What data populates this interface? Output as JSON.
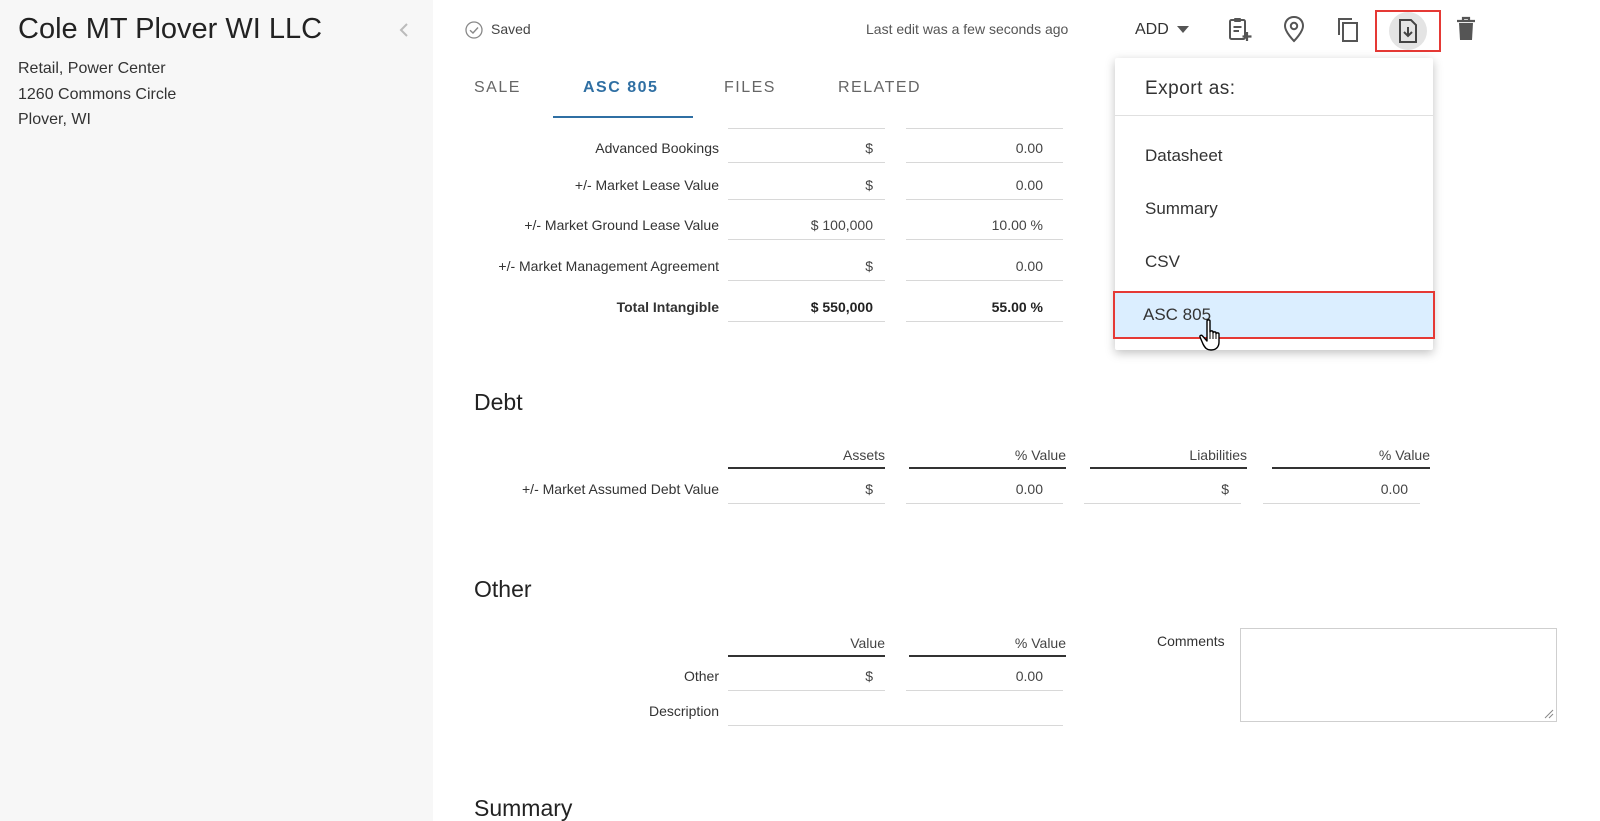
{
  "sidebar": {
    "title": "Cole MT Plover WI LLC",
    "property_type": "Retail, Power Center",
    "address_line1": "1260 Commons Circle",
    "address_line2": "Plover, WI"
  },
  "topbar": {
    "saved_label": "Saved",
    "last_edit": "Last edit was a few seconds ago",
    "add_label": "ADD"
  },
  "tabs": [
    {
      "label": "SALE"
    },
    {
      "label": "ASC 805"
    },
    {
      "label": "FILES"
    },
    {
      "label": "RELATED"
    }
  ],
  "intangible": {
    "rows": [
      {
        "label": "Advanced Bookings",
        "value": "$",
        "percent": "0.00"
      },
      {
        "label": "+/- Market Lease Value",
        "value": "$",
        "percent": "0.00"
      },
      {
        "label": "+/- Market Ground Lease Value",
        "value": "$ 100,000",
        "percent": "10.00 %"
      },
      {
        "label": "+/- Market Management Agreement",
        "value": "$",
        "percent": "0.00"
      }
    ],
    "total": {
      "label": "Total Intangible",
      "value": "$ 550,000",
      "percent": "55.00 %"
    }
  },
  "debt": {
    "title": "Debt",
    "headers": [
      "Assets",
      "% Value",
      "Liabilities",
      "% Value"
    ],
    "row": {
      "label": "+/- Market Assumed Debt Value",
      "assets": "$",
      "assets_pct": "0.00",
      "liabilities": "$",
      "liabilities_pct": "0.00"
    }
  },
  "other": {
    "title": "Other",
    "headers": [
      "Value",
      "% Value"
    ],
    "row_label": "Other",
    "value": "$",
    "percent": "0.00",
    "description_label": "Description",
    "comments_label": "Comments"
  },
  "summary": {
    "title": "Summary"
  },
  "export_menu": {
    "header": "Export as:",
    "items": [
      {
        "label": "Datasheet"
      },
      {
        "label": "Summary"
      },
      {
        "label": "CSV"
      },
      {
        "label": "ASC 805"
      }
    ]
  },
  "colors": {
    "accent": "#2f6fa3",
    "highlight_border": "#e53935",
    "highlight_fill": "#dbeeff"
  }
}
